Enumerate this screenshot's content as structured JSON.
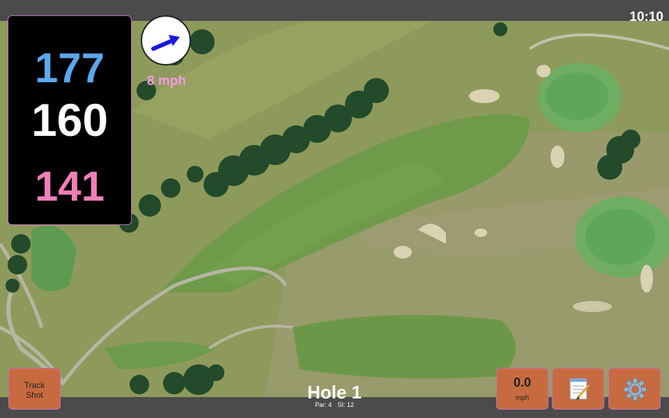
{
  "status_bar": {
    "time": "10:10"
  },
  "distances": {
    "back": "177",
    "middle": "160",
    "front": "141"
  },
  "wind": {
    "speed_label": "8 mph",
    "direction_icon": "arrow-up-right-icon",
    "arrow_color": "#1818e0"
  },
  "hole": {
    "title": "Hole 1",
    "par": "Par: 4",
    "si": "SI: 12"
  },
  "buttons": {
    "track_shot_line1": "Track",
    "track_shot_line2": "Shot",
    "wind_value": "0.0",
    "wind_unit": "mph",
    "notes_icon": "notepad-icon",
    "settings_icon": "gear-icon"
  },
  "colors": {
    "back_distance": "#5aa8ee",
    "middle_distance": "#ffffff",
    "front_distance": "#f17fb7",
    "button_bg": "#c86a3f"
  }
}
